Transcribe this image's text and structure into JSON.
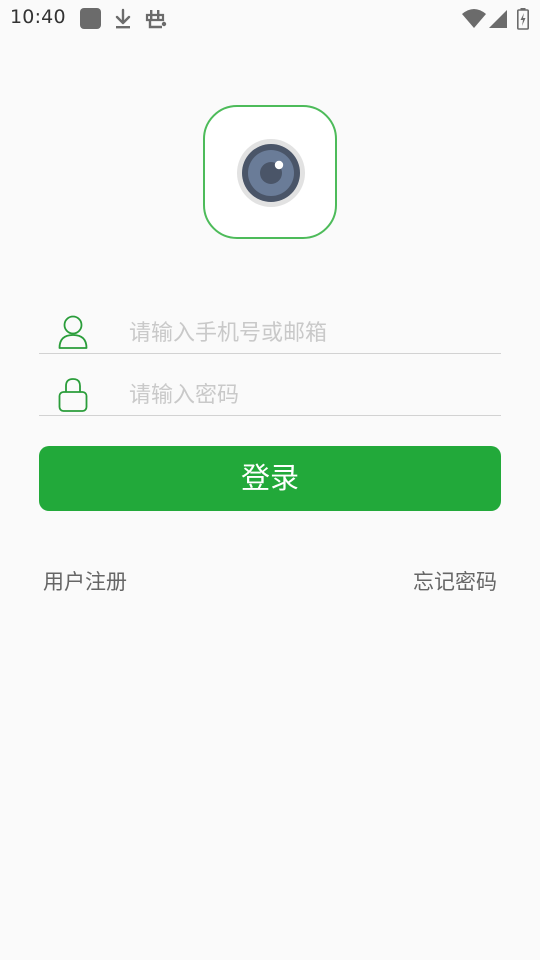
{
  "status_bar": {
    "time": "10:40",
    "icons": [
      "app-square-icon",
      "download-icon",
      "bug-icon",
      "wifi-icon",
      "signal-icon",
      "battery-icon"
    ]
  },
  "app": {
    "logo_icon": "camera-lens-icon"
  },
  "login_form": {
    "account_icon": "user-icon",
    "account_placeholder": "请输入手机号或邮箱",
    "account_value": "",
    "password_icon": "lock-icon",
    "password_placeholder": "请输入密码",
    "password_value": "",
    "login_label": "登录"
  },
  "links": {
    "register": "用户注册",
    "forgot_password": "忘记密码"
  },
  "colors": {
    "accent": "#22a93a",
    "logo_border": "#4dbb5a",
    "icon_green": "#2a9d3a",
    "background": "#fafafa"
  }
}
